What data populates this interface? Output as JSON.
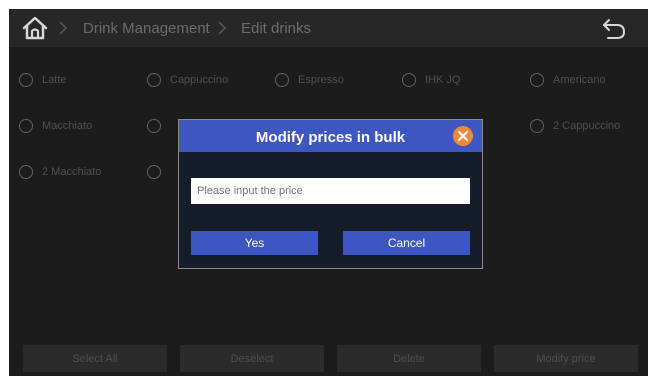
{
  "breadcrumb": {
    "section": "Drink Management",
    "page": "Edit drinks"
  },
  "drinks": {
    "latte": "Latte",
    "cappuccino": "Cappuccino",
    "espresso": "Espresso",
    "ihk_jq": "IHK JQ",
    "americano": "Americano",
    "macchiato": "Macchiato",
    "cappuccino_2": "2 Cappuccino",
    "macchiato_2": "2 Macchiato"
  },
  "dialog": {
    "title": "Modify prices in bulk",
    "input_placeholder": "Please input the price",
    "input_value": "",
    "yes_label": "Yes",
    "cancel_label": "Cancel"
  },
  "actions": {
    "select_all": "Select All",
    "deselect": "Deselect",
    "delete": "Delete",
    "modify_price": "Modify price"
  },
  "icons": {
    "home": "home-icon",
    "separator": "chevron-right-icon",
    "back": "back-arrow-icon",
    "close": "close-icon",
    "radio": "radio-unchecked-icon"
  },
  "colors": {
    "accent": "#3d56c0",
    "close": "#f08a3a",
    "background": "#1c1c1c"
  }
}
